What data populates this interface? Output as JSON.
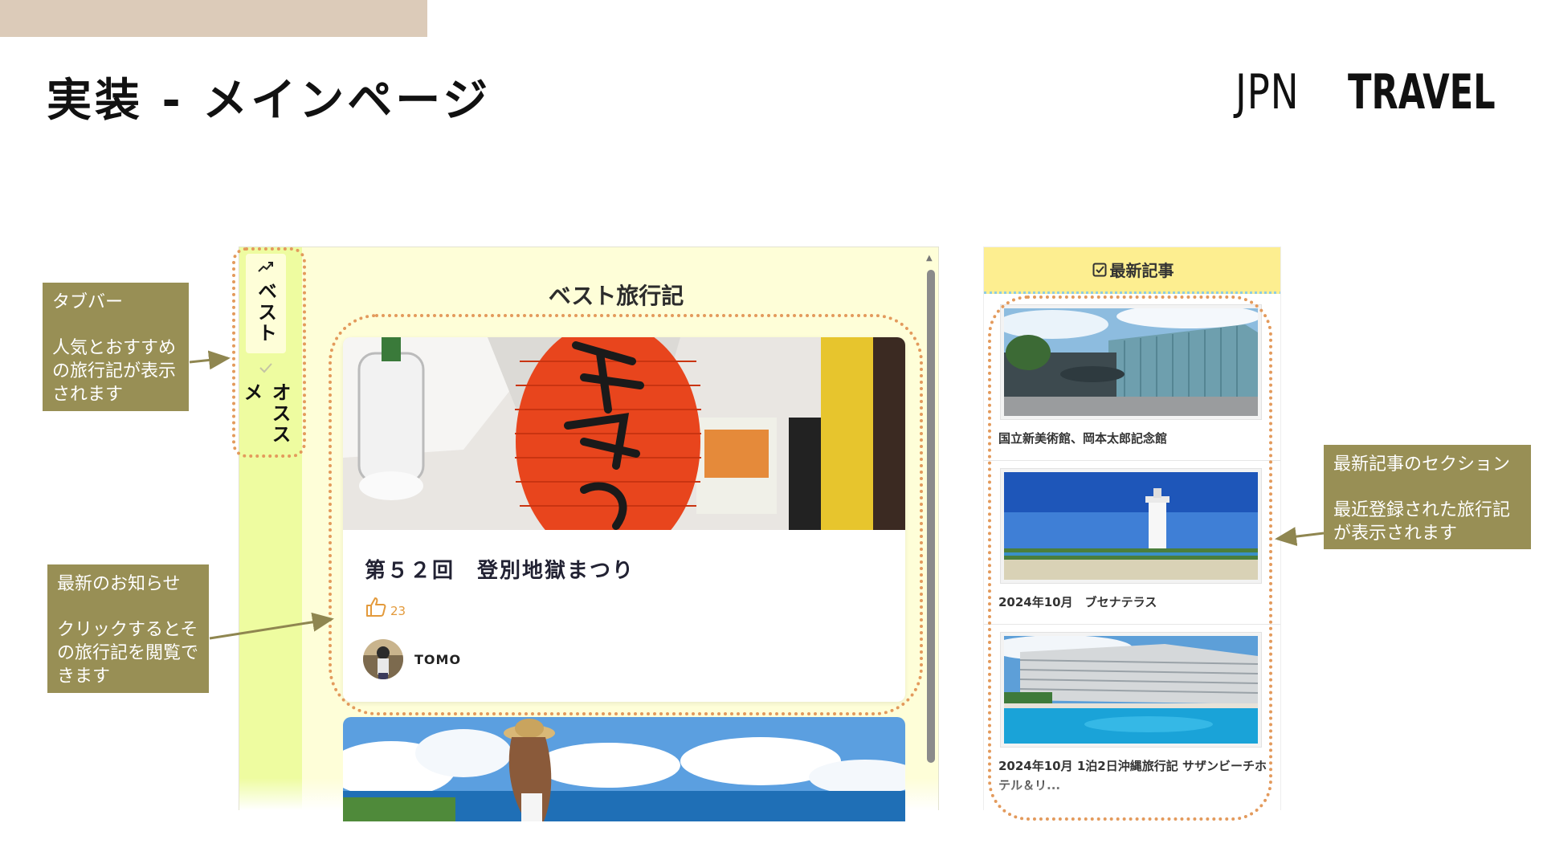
{
  "slide": {
    "title": "実装 - メインページ"
  },
  "brand": {
    "light": "JPN",
    "bold": "TRAVEL"
  },
  "tabbar": {
    "tabs": [
      {
        "icon": "trending-up-icon",
        "label": "ベスト",
        "active": true
      },
      {
        "icon": "check-icon",
        "label": "オススメ",
        "active": false
      }
    ]
  },
  "main": {
    "title": "ベスト旅行記",
    "cards": [
      {
        "title": "第５２回　登別地獄まつり",
        "likes": "23",
        "author": "TOMO",
        "image": "red paper lantern festival photo"
      },
      {
        "image": "woman with sun hat at seaside photo"
      }
    ]
  },
  "news": {
    "header": "最新記事",
    "header_icon": "checkbox-icon",
    "items": [
      {
        "text": "国立新美術館、岡本太郎記念館",
        "image": "modern glass museum building photo"
      },
      {
        "text": "2024年10月　ブセナテラス",
        "image": "white lighthouse by the sea photo"
      },
      {
        "text": "2024年10月 1泊2日沖縄旅行記 サザンビーチホテル＆リ...",
        "image": "resort hotel with pool photo"
      }
    ]
  },
  "callouts": {
    "tabbar": {
      "title": "タブバー",
      "body": "人気とおすすめの旅行記が表示されます"
    },
    "news_card": {
      "title": "最新のお知らせ",
      "body": "クリックするとその旅行記を閲覧できます"
    },
    "latest": {
      "title": "最新記事のセクション",
      "body": "最近登録された旅行記が表示されます"
    }
  },
  "colors": {
    "accent_orange": "#e39a5c",
    "callout_bg": "#988f55",
    "tabbar_bg": "#eefca0",
    "news_header_bg": "#fdee90"
  }
}
